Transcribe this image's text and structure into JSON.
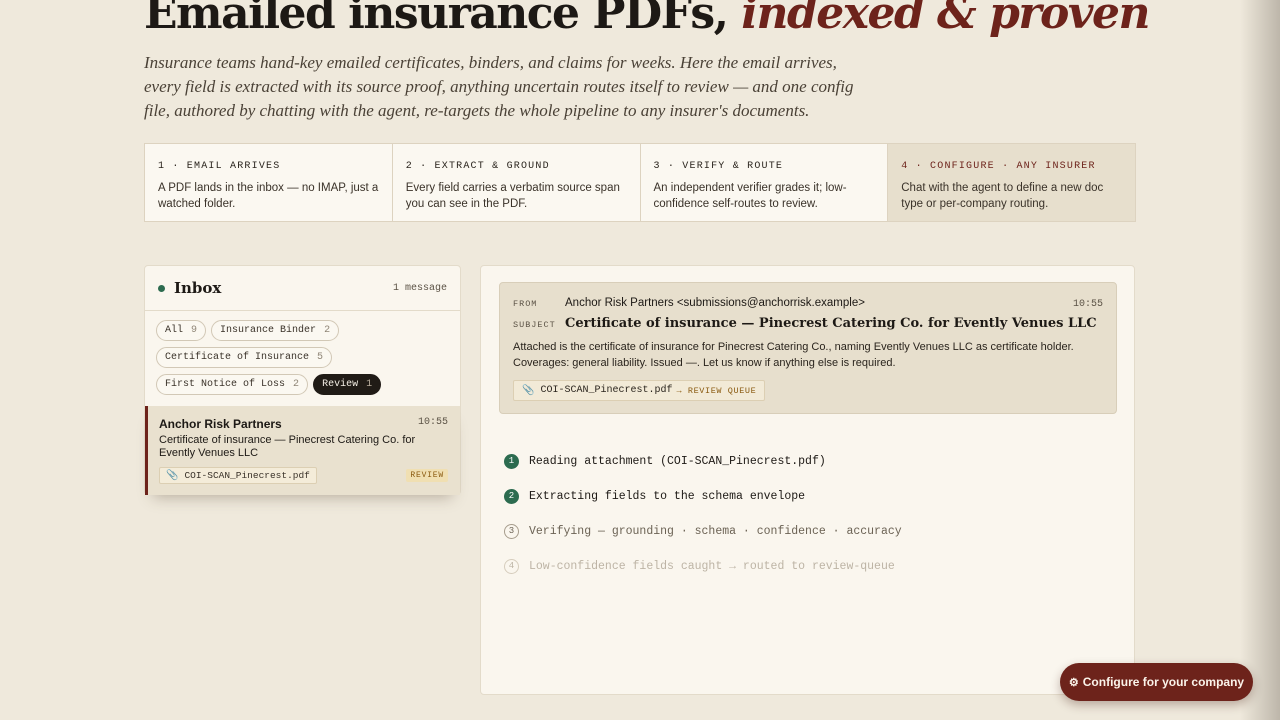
{
  "hero": {
    "title_main": "Emailed insurance PDFs,",
    "title_accent": "indexed & proven",
    "subtitle": "Insurance teams hand-key emailed certificates, binders, and claims for weeks. Here the email arrives, every field is extracted with its source proof, anything uncertain routes itself to review — and one config file, authored by chatting with the agent, re-targets the whole pipeline to any insurer's documents."
  },
  "steps": [
    {
      "title": "1 · EMAIL ARRIVES",
      "desc": "A PDF lands in the inbox — no IMAP, just a watched folder."
    },
    {
      "title": "2 · EXTRACT & GROUND",
      "desc": "Every field carries a verbatim source span you can see in the PDF."
    },
    {
      "title": "3 · VERIFY & ROUTE",
      "desc": "An independent verifier grades it; low-confidence self-routes to review."
    },
    {
      "title": "4 · CONFIGURE · ANY INSURER",
      "desc": "Chat with the agent to define a new doc type or per-company routing."
    }
  ],
  "inbox": {
    "title": "Inbox",
    "count": "1 message",
    "filters": [
      {
        "label": "All",
        "n": "9"
      },
      {
        "label": "Insurance Binder",
        "n": "2"
      },
      {
        "label": "Certificate of Insurance",
        "n": "5"
      },
      {
        "label": "First Notice of Loss",
        "n": "2"
      },
      {
        "label": "Review",
        "n": "1"
      }
    ],
    "message": {
      "sender": "Anchor Risk Partners",
      "time": "10:55",
      "subject": "Certificate of insurance — Pinecrest Catering Co. for Evently Venues LLC",
      "attachment": "COI-SCAN_Pinecrest.pdf",
      "badge": "REVIEW"
    }
  },
  "email": {
    "from_label": "FROM",
    "from": "Anchor Risk Partners <submissions@anchorrisk.example>",
    "time": "10:55",
    "subject_label": "SUBJECT",
    "subject": "Certificate of insurance — Pinecrest Catering Co. for Evently Venues LLC",
    "body": "Attached is the certificate of insurance for Pinecrest Catering Co., naming Evently Venues LLC as certificate holder. Coverages: general liability. Issued —. Let us know if anything else is required.",
    "attachment": "COI-SCAN_Pinecrest.pdf",
    "route": "→ REVIEW QUEUE"
  },
  "pipeline": [
    {
      "num": "1",
      "text": "Reading attachment (COI-SCAN_Pinecrest.pdf)",
      "state": "done"
    },
    {
      "num": "2",
      "text": "Extracting fields to the schema envelope",
      "state": "done"
    },
    {
      "num": "3",
      "text": "Verifying — grounding · schema · confidence · accuracy",
      "state": "active"
    },
    {
      "num": "4",
      "text": "Low-confidence fields caught → routed to review-queue",
      "state": "pending"
    }
  ],
  "cta": {
    "icon": "gear-icon",
    "label": "Configure for your company"
  },
  "colors": {
    "accent": "#6d231b",
    "success": "#2c6b4f",
    "background": "#efe9dc"
  }
}
